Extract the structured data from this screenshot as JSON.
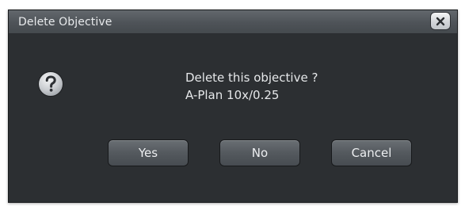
{
  "dialog": {
    "title": "Delete Objective",
    "close_icon": "close-icon",
    "question_icon": "question-icon"
  },
  "message": {
    "line1": "Delete this objective ?",
    "line2": "A-Plan 10x/0.25"
  },
  "buttons": {
    "yes": "Yes",
    "no": "No",
    "cancel": "Cancel"
  },
  "colors": {
    "dialog_background": "#2c2f32",
    "titlebar": "#4e5358",
    "button": "#54595e",
    "text": "#e6e8ea"
  }
}
